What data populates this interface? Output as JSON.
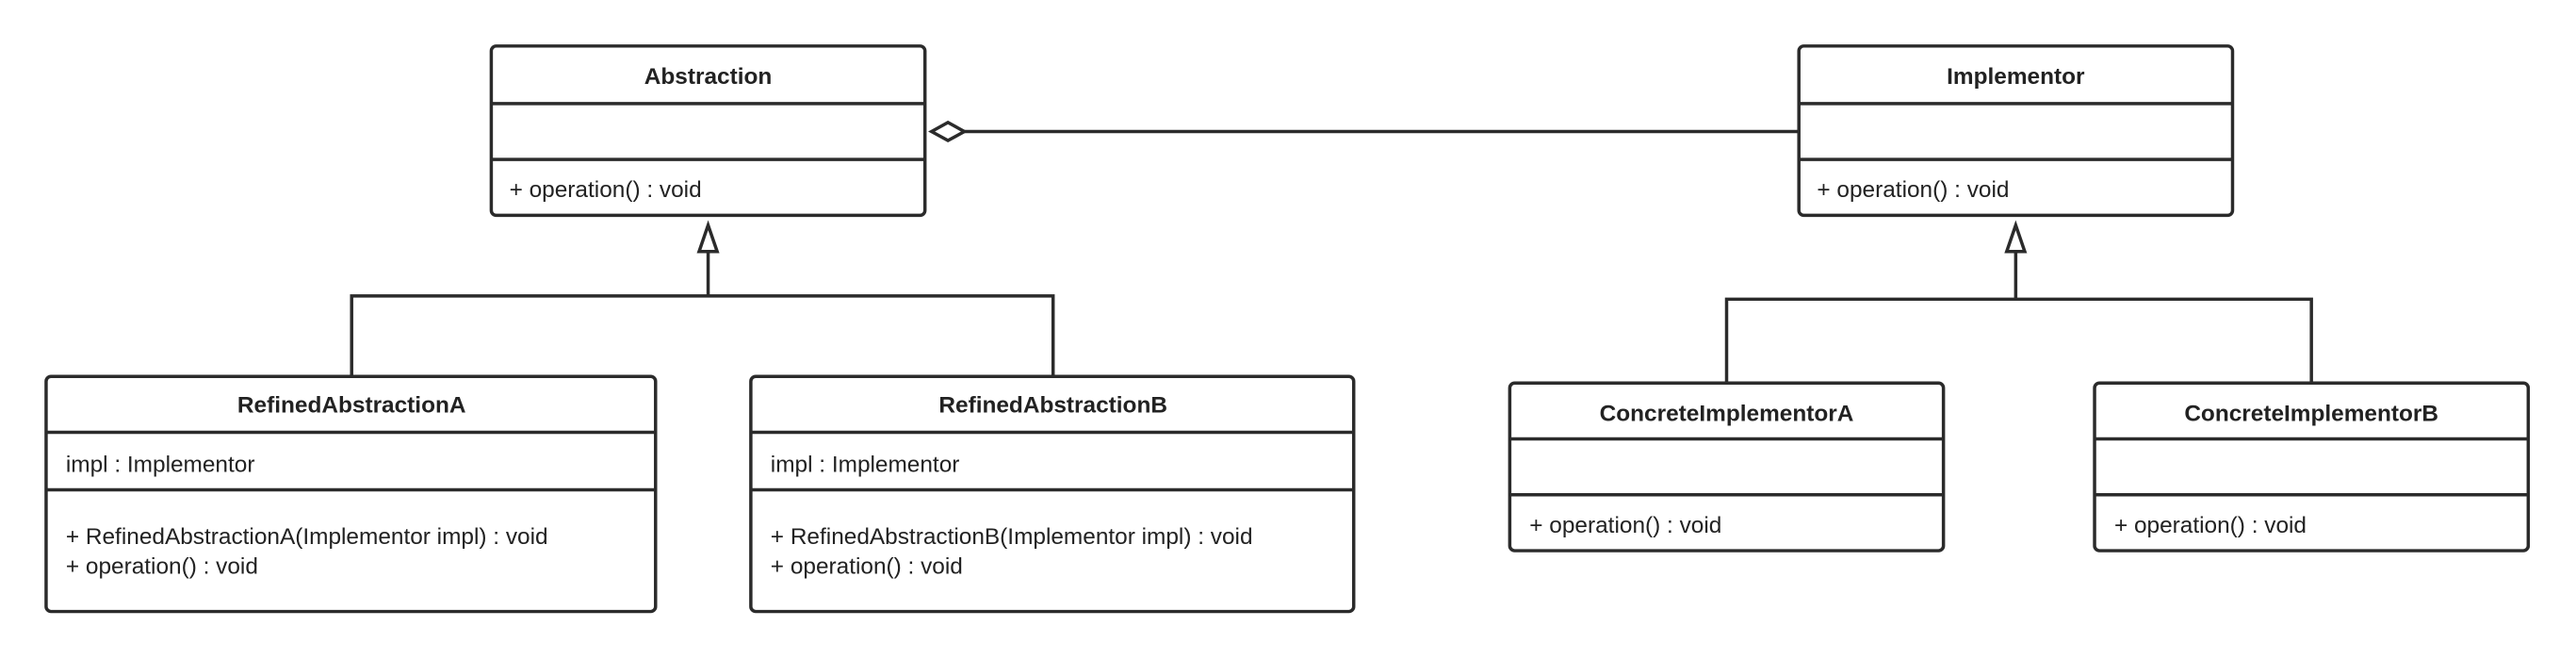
{
  "classes": {
    "abstraction": {
      "name": "Abstraction",
      "attributes": [],
      "methods": [
        "+ operation() : void"
      ]
    },
    "implementor": {
      "name": "Implementor",
      "attributes": [],
      "methods": [
        "+ operation() : void"
      ]
    },
    "refinedA": {
      "name": "RefinedAbstractionA",
      "attributes": [
        "impl : Implementor"
      ],
      "methods": [
        "+ RefinedAbstractionA(Implementor impl) : void",
        "+ operation() : void"
      ]
    },
    "refinedB": {
      "name": "RefinedAbstractionB",
      "attributes": [
        "impl : Implementor"
      ],
      "methods": [
        "+ RefinedAbstractionB(Implementor impl) : void",
        "+ operation() : void"
      ]
    },
    "concreteA": {
      "name": "ConcreteImplementorA",
      "attributes": [],
      "methods": [
        "+ operation() : void"
      ]
    },
    "concreteB": {
      "name": "ConcreteImplementorB",
      "attributes": [],
      "methods": [
        "+ operation() : void"
      ]
    }
  },
  "relations": [
    {
      "type": "aggregation",
      "from": "Abstraction",
      "to": "Implementor"
    },
    {
      "type": "generalization",
      "from": "RefinedAbstractionA",
      "to": "Abstraction"
    },
    {
      "type": "generalization",
      "from": "RefinedAbstractionB",
      "to": "Abstraction"
    },
    {
      "type": "generalization",
      "from": "ConcreteImplementorA",
      "to": "Implementor"
    },
    {
      "type": "generalization",
      "from": "ConcreteImplementorB",
      "to": "Implementor"
    }
  ],
  "colors": {
    "stroke": "#2b2b2b",
    "background": "#ffffff"
  }
}
